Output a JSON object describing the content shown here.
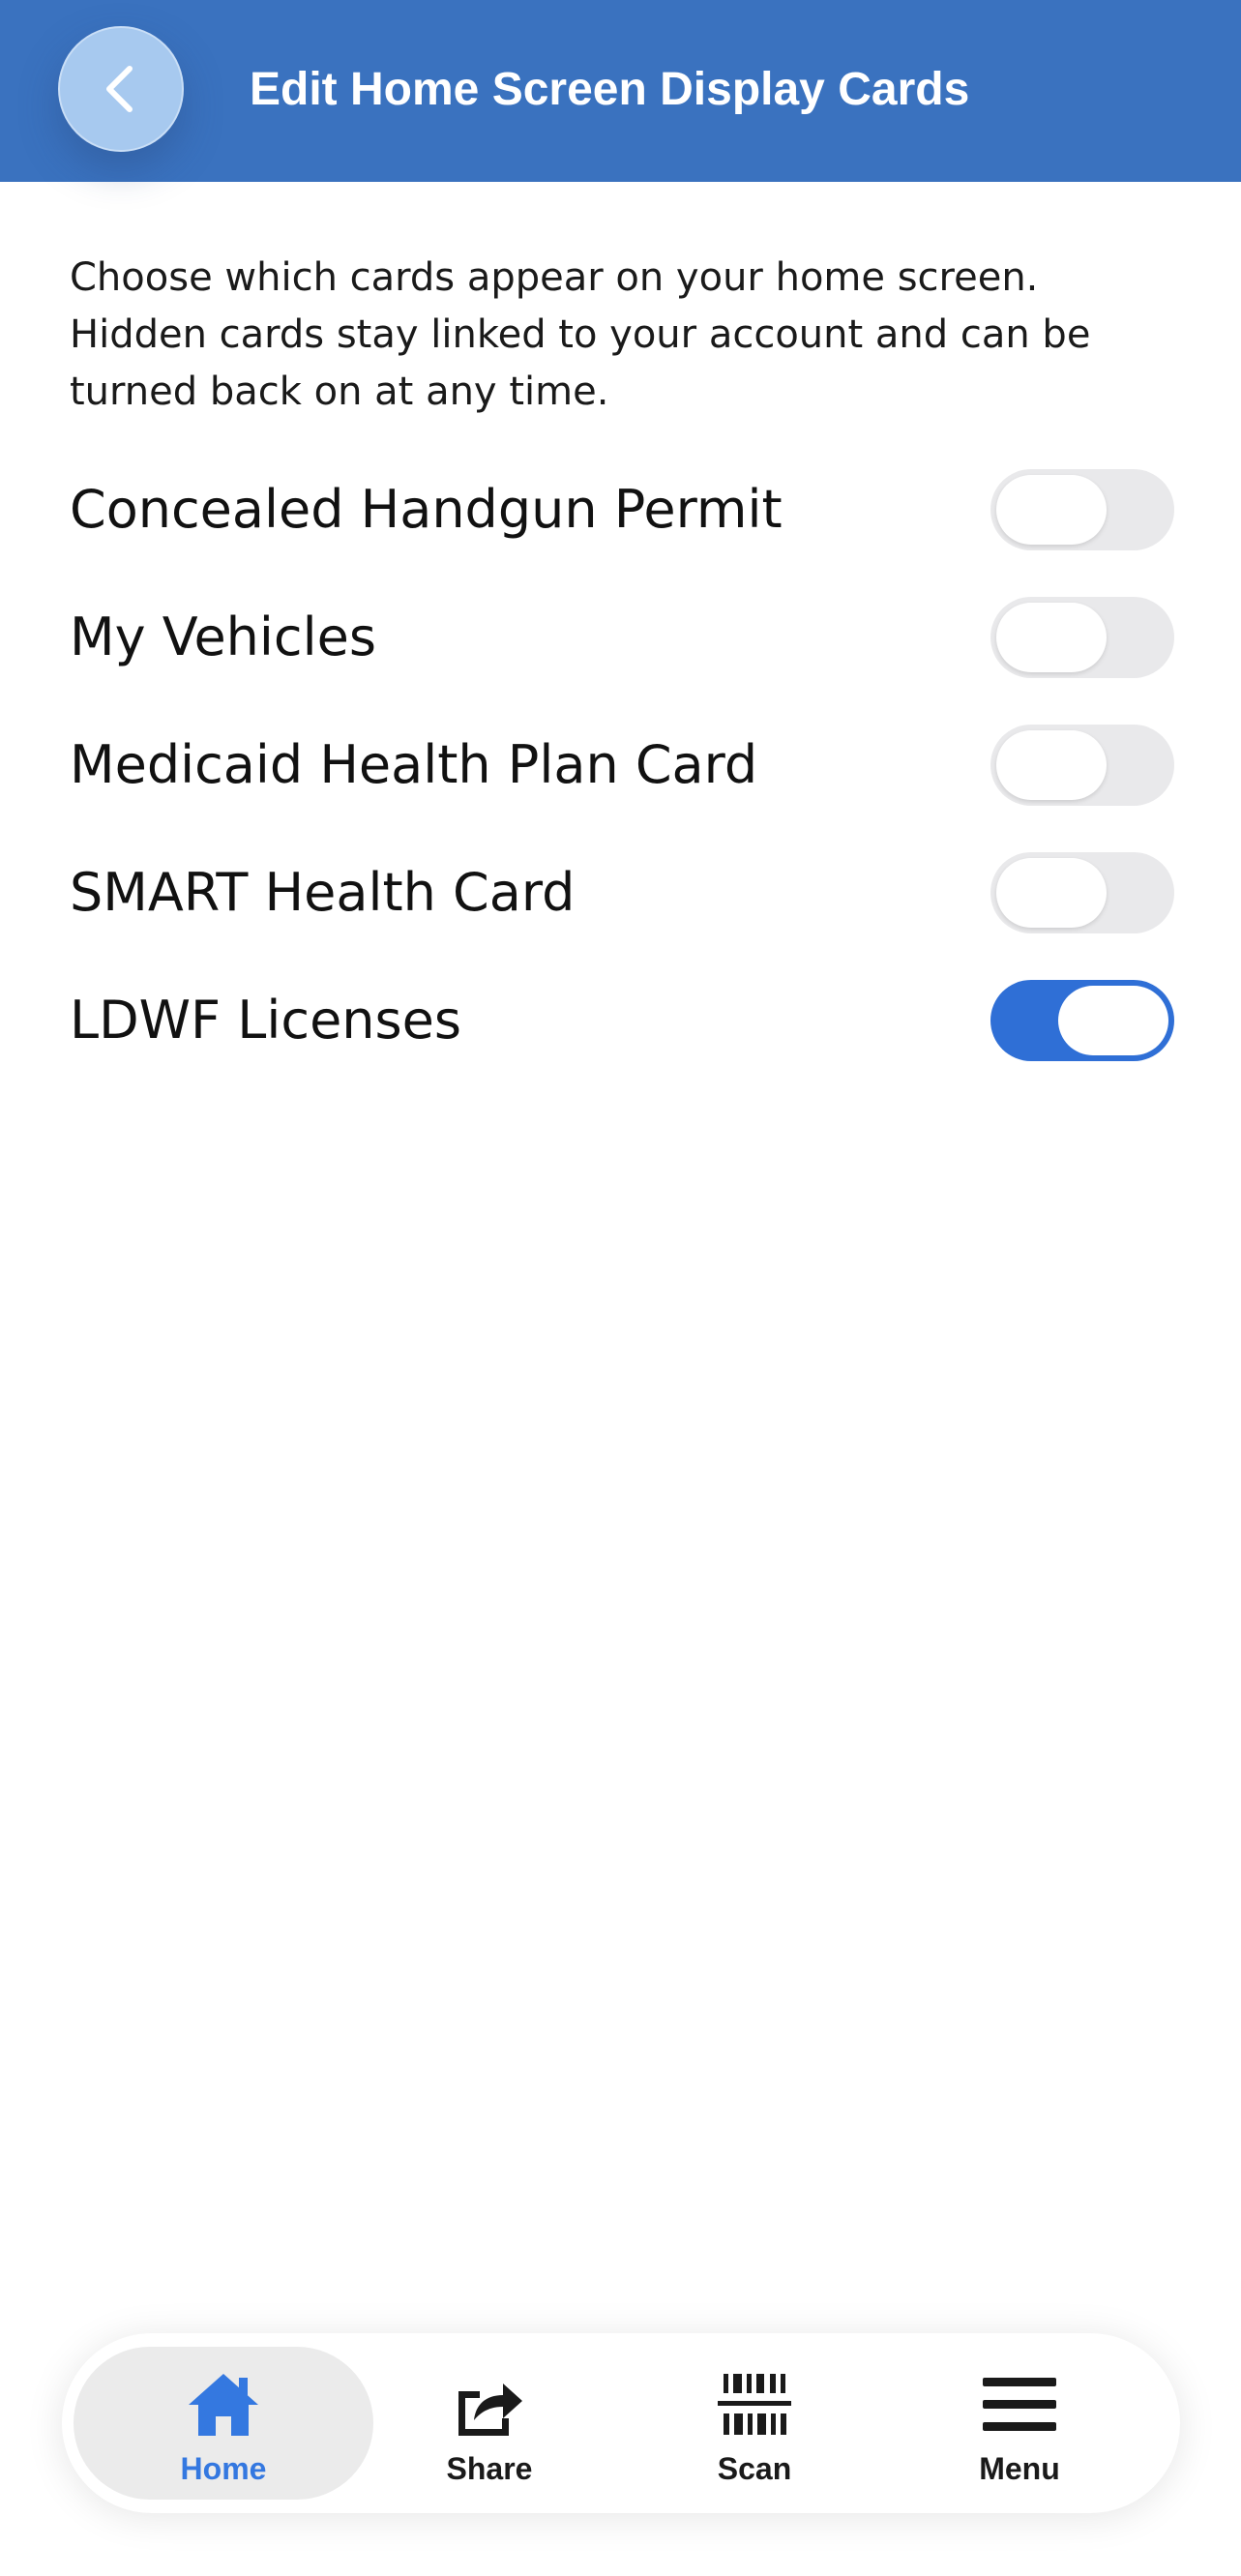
{
  "header": {
    "title": "Edit Home Screen Display Cards"
  },
  "intro": {
    "text": "Choose which cards appear on your home screen. Hidden cards stay linked to your account and can be turned back on at any time."
  },
  "cards": [
    {
      "label": "Concealed Handgun Permit",
      "enabled": false
    },
    {
      "label": "My Vehicles",
      "enabled": false
    },
    {
      "label": "Medicaid Health Plan Card",
      "enabled": false
    },
    {
      "label": "SMART Health Card",
      "enabled": false
    },
    {
      "label": "LDWF Licenses",
      "enabled": true
    }
  ],
  "tabbar": {
    "items": [
      {
        "label": "Home",
        "icon": "home-icon",
        "active": true
      },
      {
        "label": "Share",
        "icon": "share-icon",
        "active": false
      },
      {
        "label": "Scan",
        "icon": "barcode-icon",
        "active": false
      },
      {
        "label": "Menu",
        "icon": "menu-icon",
        "active": false
      }
    ]
  },
  "colors": {
    "header": "#3a72bf",
    "toggle_on": "#2f6fd6",
    "toggle_off": "#e9e9eb",
    "active_tab_text": "#3478e0"
  }
}
